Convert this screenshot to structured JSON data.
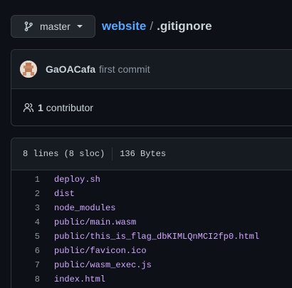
{
  "branch": {
    "name": "master"
  },
  "breadcrumb": {
    "repo": "website",
    "separator": "/",
    "file": ".gitignore"
  },
  "commit": {
    "author": "GaOACafa",
    "message": "first commit"
  },
  "contributors": {
    "count": "1",
    "label": "contributor"
  },
  "file_info": {
    "lines": "8 lines (8 sloc)",
    "size": "136 Bytes"
  },
  "code_lines": [
    {
      "num": "1",
      "text": "deploy.sh"
    },
    {
      "num": "2",
      "text": "dist"
    },
    {
      "num": "3",
      "text": "node_modules"
    },
    {
      "num": "4",
      "text": "public/main.wasm"
    },
    {
      "num": "5",
      "text": "public/this_is_flag_dbKIMLQnMCI2fp0.html"
    },
    {
      "num": "6",
      "text": "public/favicon.ico"
    },
    {
      "num": "7",
      "text": "public/wasm_exec.js"
    },
    {
      "num": "8",
      "text": "index.html"
    }
  ],
  "colors": {
    "background": "#0d1117",
    "link": "#58a6ff",
    "code_text": "#d2a8ff",
    "muted": "#8b949e"
  }
}
